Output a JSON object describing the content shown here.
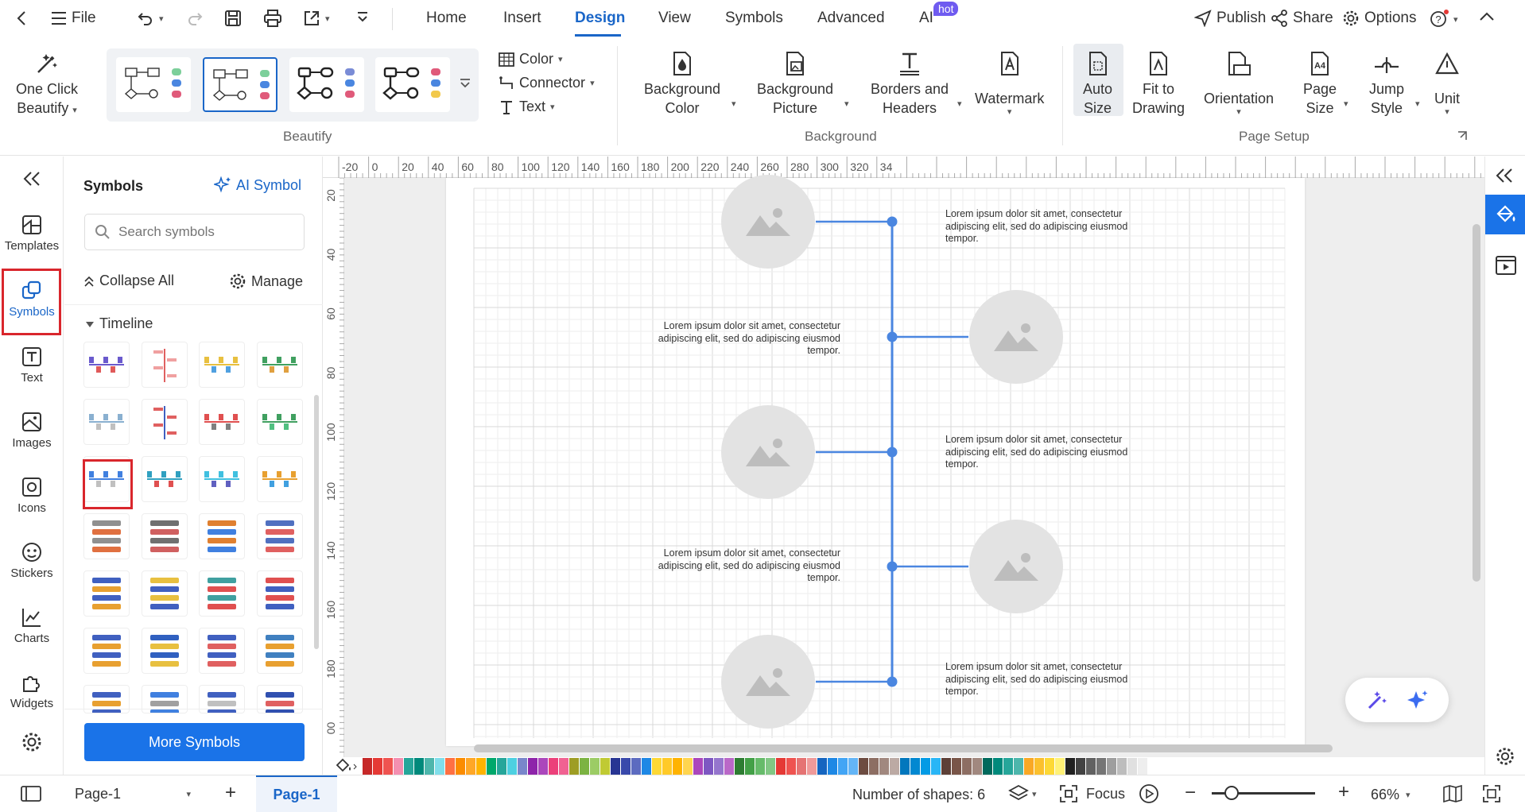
{
  "topbar": {
    "file_label": "File",
    "tabs": [
      {
        "label": "Home"
      },
      {
        "label": "Insert"
      },
      {
        "label": "Design"
      },
      {
        "label": "View"
      },
      {
        "label": "Symbols"
      },
      {
        "label": "Advanced"
      },
      {
        "label": "AI"
      }
    ],
    "ai_badge": "hot",
    "publish": "Publish",
    "share": "Share",
    "options": "Options"
  },
  "ribbon": {
    "one_click_line1": "One Click",
    "one_click_line2": "Beautify",
    "beautify_group": "Beautify",
    "color": "Color",
    "connector": "Connector",
    "text": "Text",
    "bg_color_line1": "Background",
    "bg_color_line2": "Color",
    "bg_picture_line1": "Background",
    "bg_picture_line2": "Picture",
    "borders_line1": "Borders and",
    "borders_line2": "Headers",
    "watermark": "Watermark",
    "background_group": "Background",
    "auto_size_line1": "Auto",
    "auto_size_line2": "Size",
    "fit_line1": "Fit to",
    "fit_line2": "Drawing",
    "orientation": "Orientation",
    "page_size_line1": "Page",
    "page_size_line2": "Size",
    "page_size_icon_text": "A4",
    "jump_line1": "Jump",
    "jump_line2": "Style",
    "unit": "Unit",
    "page_setup_group": "Page Setup"
  },
  "leftnav": {
    "items": [
      {
        "label": "Templates"
      },
      {
        "label": "Symbols"
      },
      {
        "label": "Text"
      },
      {
        "label": "Images"
      },
      {
        "label": "Icons"
      },
      {
        "label": "Stickers"
      },
      {
        "label": "Charts"
      },
      {
        "label": "Widgets"
      }
    ]
  },
  "symbols": {
    "title": "Symbols",
    "ai_symbol": "AI Symbol",
    "search_placeholder": "Search symbols",
    "collapse_all": "Collapse All",
    "manage": "Manage",
    "category": "Timeline",
    "more_symbols": "More Symbols"
  },
  "ruler": {
    "h_ticks": [
      "-20",
      "0",
      "20",
      "40",
      "60",
      "80",
      "100",
      "120",
      "140",
      "160",
      "180",
      "200",
      "220",
      "240",
      "260",
      "280",
      "300",
      "320",
      "34"
    ],
    "v_ticks": [
      "20",
      "40",
      "60",
      "80",
      "100",
      "120",
      "140",
      "160",
      "180",
      "00"
    ]
  },
  "diagram": {
    "lorem": "Lorem ipsum dolor sit amet, consectetur adipiscing elit, sed do adipiscing eiusmod tempor.",
    "line_color": "#4a86e0"
  },
  "status": {
    "page_select": "Page-1",
    "page_tab": "Page-1",
    "shape_count": "Number of shapes: 6",
    "focus": "Focus",
    "zoom": "66%"
  },
  "colors": {
    "accent": "#1a66c8",
    "primary_button": "#1a73e8",
    "highlight_red": "#d9262c"
  }
}
